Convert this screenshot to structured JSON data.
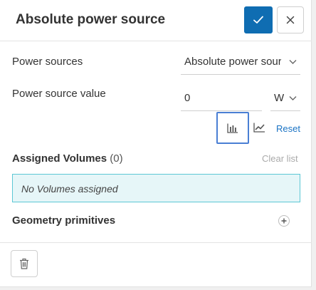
{
  "header": {
    "title": "Absolute power source",
    "confirm_icon": "check-icon",
    "close_icon": "close-icon",
    "accent_color": "#0f6db2"
  },
  "form": {
    "power_sources_label": "Power sources",
    "power_sources_value": "Absolute power sour",
    "power_source_value_label": "Power source value",
    "power_source_value": "0",
    "unit_value": "W",
    "constant_icon": "bar-chart-icon",
    "table_icon": "line-chart-icon",
    "reset_label": "Reset"
  },
  "assigned": {
    "title": "Assigned Volumes",
    "count": "(0)",
    "clear_label": "Clear list",
    "empty_text": "No Volumes assigned"
  },
  "geometry": {
    "title": "Geometry primitives",
    "add_icon": "plus-icon"
  },
  "footer": {
    "delete_icon": "trash-icon"
  }
}
